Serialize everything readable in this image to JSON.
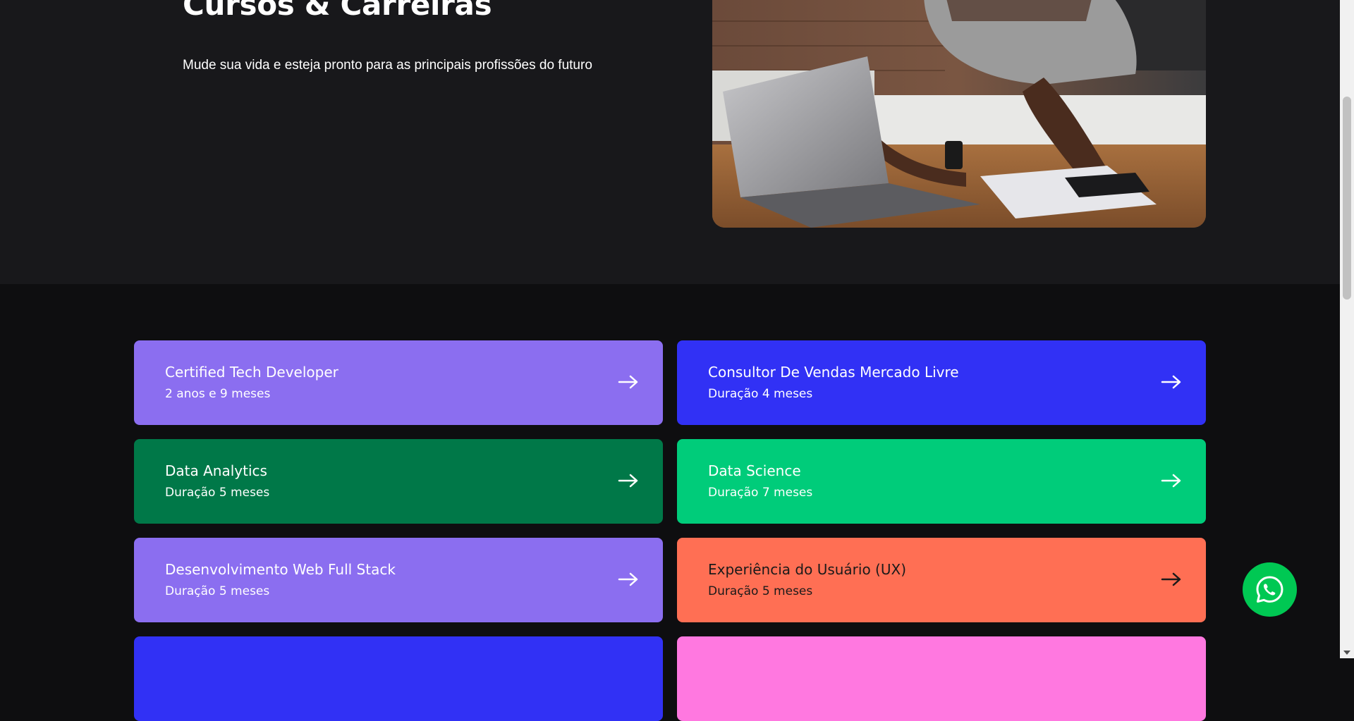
{
  "hero": {
    "title": "Cursos & Carreiras",
    "subtitle": "Mude sua vida e esteja pronto para as principais profissões do futuro",
    "image_alt": "person-typing-on-laptop"
  },
  "courses": [
    {
      "name": "Certified Tech Developer",
      "duration": "2 anos e 9 meses",
      "color": "#8b6ef0"
    },
    {
      "name": "Consultor De Vendas Mercado Livre",
      "duration": "Duração 4 meses",
      "color": "#3131f5"
    },
    {
      "name": "Data Analytics",
      "duration": "Duração 5 meses",
      "color": "#007848"
    },
    {
      "name": "Data Science",
      "duration": "Duração 7 meses",
      "color": "#00cc7a"
    },
    {
      "name": "Desenvolvimento Web Full Stack",
      "duration": "Duração 5 meses",
      "color": "#8b6ef0"
    },
    {
      "name": "Experiência do Usuário (UX)",
      "duration": "Duração 5 meses",
      "color": "#ff6f54"
    },
    {
      "name": "",
      "duration": "",
      "color": "#3131f5"
    },
    {
      "name": "",
      "duration": "",
      "color": "#ff78e0"
    }
  ],
  "icons": {
    "arrow": "arrow-right-icon",
    "whatsapp": "whatsapp-icon"
  },
  "colors": {
    "hero_bg": "#18181b",
    "page_bg": "#0e0e10",
    "whatsapp": "#00c853"
  }
}
